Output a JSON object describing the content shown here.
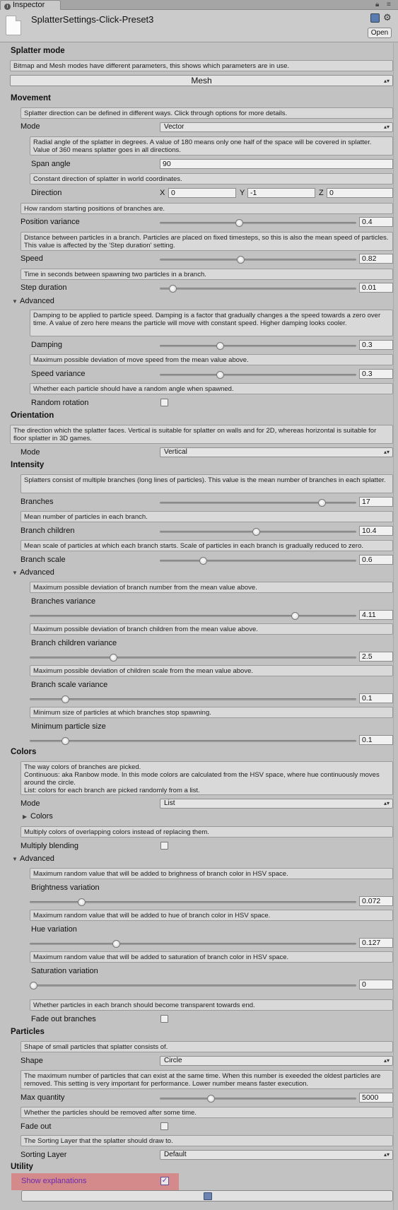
{
  "tab": {
    "label": "Inspector"
  },
  "header": {
    "title": "SplatterSettings-Click-Preset3",
    "open_label": "Open"
  },
  "splatter_mode": {
    "heading": "Splatter mode",
    "help": "Bitmap and Mesh modes have different parameters, this shows which parameters are in use.",
    "value": "Mesh"
  },
  "movement": {
    "heading": "Movement",
    "help_direction": "Splatter direction can be defined in different ways. Click through options for more details.",
    "mode_label": "Mode",
    "mode_value": "Vector",
    "help_span": "Radial angle of the splatter in degrees. A value of 180 means only one half of the space will be covered in splatter. Value of 360 means splatter goes in all directions.",
    "span_label": "Span angle",
    "span_value": "90",
    "help_dir": "Constant direction of splatter in world coordinates.",
    "direction_label": "Direction",
    "dir_x_label": "X",
    "dir_x": "0",
    "dir_y_label": "Y",
    "dir_y": "-1",
    "dir_z_label": "Z",
    "dir_z": "0",
    "help_posvar": "How random starting positions of branches are.",
    "posvar_label": "Position variance",
    "posvar_value": "0.4",
    "posvar_frac": 0.4,
    "help_speed": "Distance between particles in a branch. Particles are placed on fixed timesteps, so this is also the mean speed of particles. This value is affected by the 'Step duration' setting.",
    "speed_label": "Speed",
    "speed_value": "0.82",
    "speed_frac": 0.41,
    "help_step": "Time in seconds between spawning two particles in a branch.",
    "step_label": "Step duration",
    "step_value": "0.01",
    "step_frac": 0.05,
    "advanced_label": "Advanced",
    "help_damping": "Damping to be applied to particle speed. Damping is a factor that gradually changes a the speed towards a zero over time. A value of zero here means the particle will move with constant speed. Higher damping looks cooler.",
    "damping_label": "Damping",
    "damping_value": "0.3",
    "damping_frac": 0.3,
    "help_speedvar": "Maximum possible deviation of move speed from the mean value above.",
    "speedvar_label": "Speed variance",
    "speedvar_value": "0.3",
    "speedvar_frac": 0.3,
    "help_randrot": "Whether each particle should have a random angle when spawned.",
    "randrot_label": "Random rotation",
    "randrot_checked": false
  },
  "orientation": {
    "heading": "Orientation",
    "help": "The direction which the splatter faces. Vertical is suitable for splatter on walls and for 2D, whereas horizontal is suitable for floor splatter in 3D games.",
    "mode_label": "Mode",
    "mode_value": "Vertical"
  },
  "intensity": {
    "heading": "Intensity",
    "help_branches": "Splatters consist of multiple branches (long lines of particles). This value is the mean number of branches in each splatter.",
    "branches_label": "Branches",
    "branches_value": "17",
    "branches_frac": 0.84,
    "help_children": "Mean number of particles in each branch.",
    "children_label": "Branch children",
    "children_value": "10.4",
    "children_frac": 0.49,
    "help_scale": "Mean scale of particles at which each branch starts. Scale of particles in each branch is gradually reduced to zero.",
    "scale_label": "Branch scale",
    "scale_value": "0.6",
    "scale_frac": 0.21,
    "advanced_label": "Advanced",
    "help_brvar": "Maximum possible deviation of branch number from the mean value above.",
    "brvar_label": "Branches variance",
    "brvar_value": "4.11",
    "brvar_frac": 0.82,
    "help_chvar": "Maximum possible deviation of branch children from the mean value above.",
    "chvar_label": "Branch children variance",
    "chvar_value": "2.5",
    "chvar_frac": 0.25,
    "help_scvar": "Maximum possible deviation of children scale from the mean value above.",
    "scvar_label": "Branch scale variance",
    "scvar_value": "0.1",
    "scvar_frac": 0.1,
    "help_minsize": "Minimum size of particles at which branches stop spawning.",
    "minsize_label": "Minimum particle size",
    "minsize_value": "0.1",
    "minsize_frac": 0.1
  },
  "colors": {
    "heading": "Colors",
    "help_line1": "The way colors of branches are picked.",
    "help_line2": "Continuous: aka Ranbow mode. In this mode colors are calculated from the HSV space, where hue continuously moves around the circle.",
    "help_line3": "List: colors for each branch are picked randomly from a list.",
    "mode_label": "Mode",
    "mode_value": "List",
    "colors_fold": "Colors",
    "help_mult": "Multiply colors of overlapping colors instead of replacing them.",
    "mult_label": "Multiply blending",
    "mult_checked": false,
    "advanced_label": "Advanced",
    "help_bright": "Maximum random value that will be added to brighness of branch color in HSV space.",
    "bright_label": "Brightness variation",
    "bright_value": "0.072",
    "bright_frac": 0.15,
    "help_hue": "Maximum random value that will be added to hue of branch color in HSV space.",
    "hue_label": "Hue variation",
    "hue_value": "0.127",
    "hue_frac": 0.26,
    "help_sat": "Maximum random value that will be added to saturation of branch color in HSV space.",
    "sat_label": "Saturation variation",
    "sat_value": "0",
    "sat_frac": 0.0,
    "help_fade": "Whether particles in each branch should become transparent towards end.",
    "fade_label": "Fade out branches",
    "fade_checked": false
  },
  "particles": {
    "heading": "Particles",
    "help_shape": "Shape of small particles that splatter consists of.",
    "shape_label": "Shape",
    "shape_value": "Circle",
    "help_max": "The maximum number of particles that can exist at the same time. When this number is exeeded the oldest particles are removed. This setting is very important for performance. Lower number means faster execution.",
    "max_label": "Max quantity",
    "max_value": "5000",
    "max_frac": 0.25,
    "help_fade": "Whether the particles should be removed after some time.",
    "fade_label": "Fade out",
    "fade_checked": false,
    "help_sort": "The Sorting Layer that the splatter should draw to.",
    "sort_label": "Sorting Layer",
    "sort_value": "Default"
  },
  "utility": {
    "heading": "Utility",
    "show_exp_label": "Show explanations",
    "show_exp_checked": true
  },
  "colors_theme": {
    "highlight": "#d48a8a",
    "accent": "#6a2ab0"
  }
}
